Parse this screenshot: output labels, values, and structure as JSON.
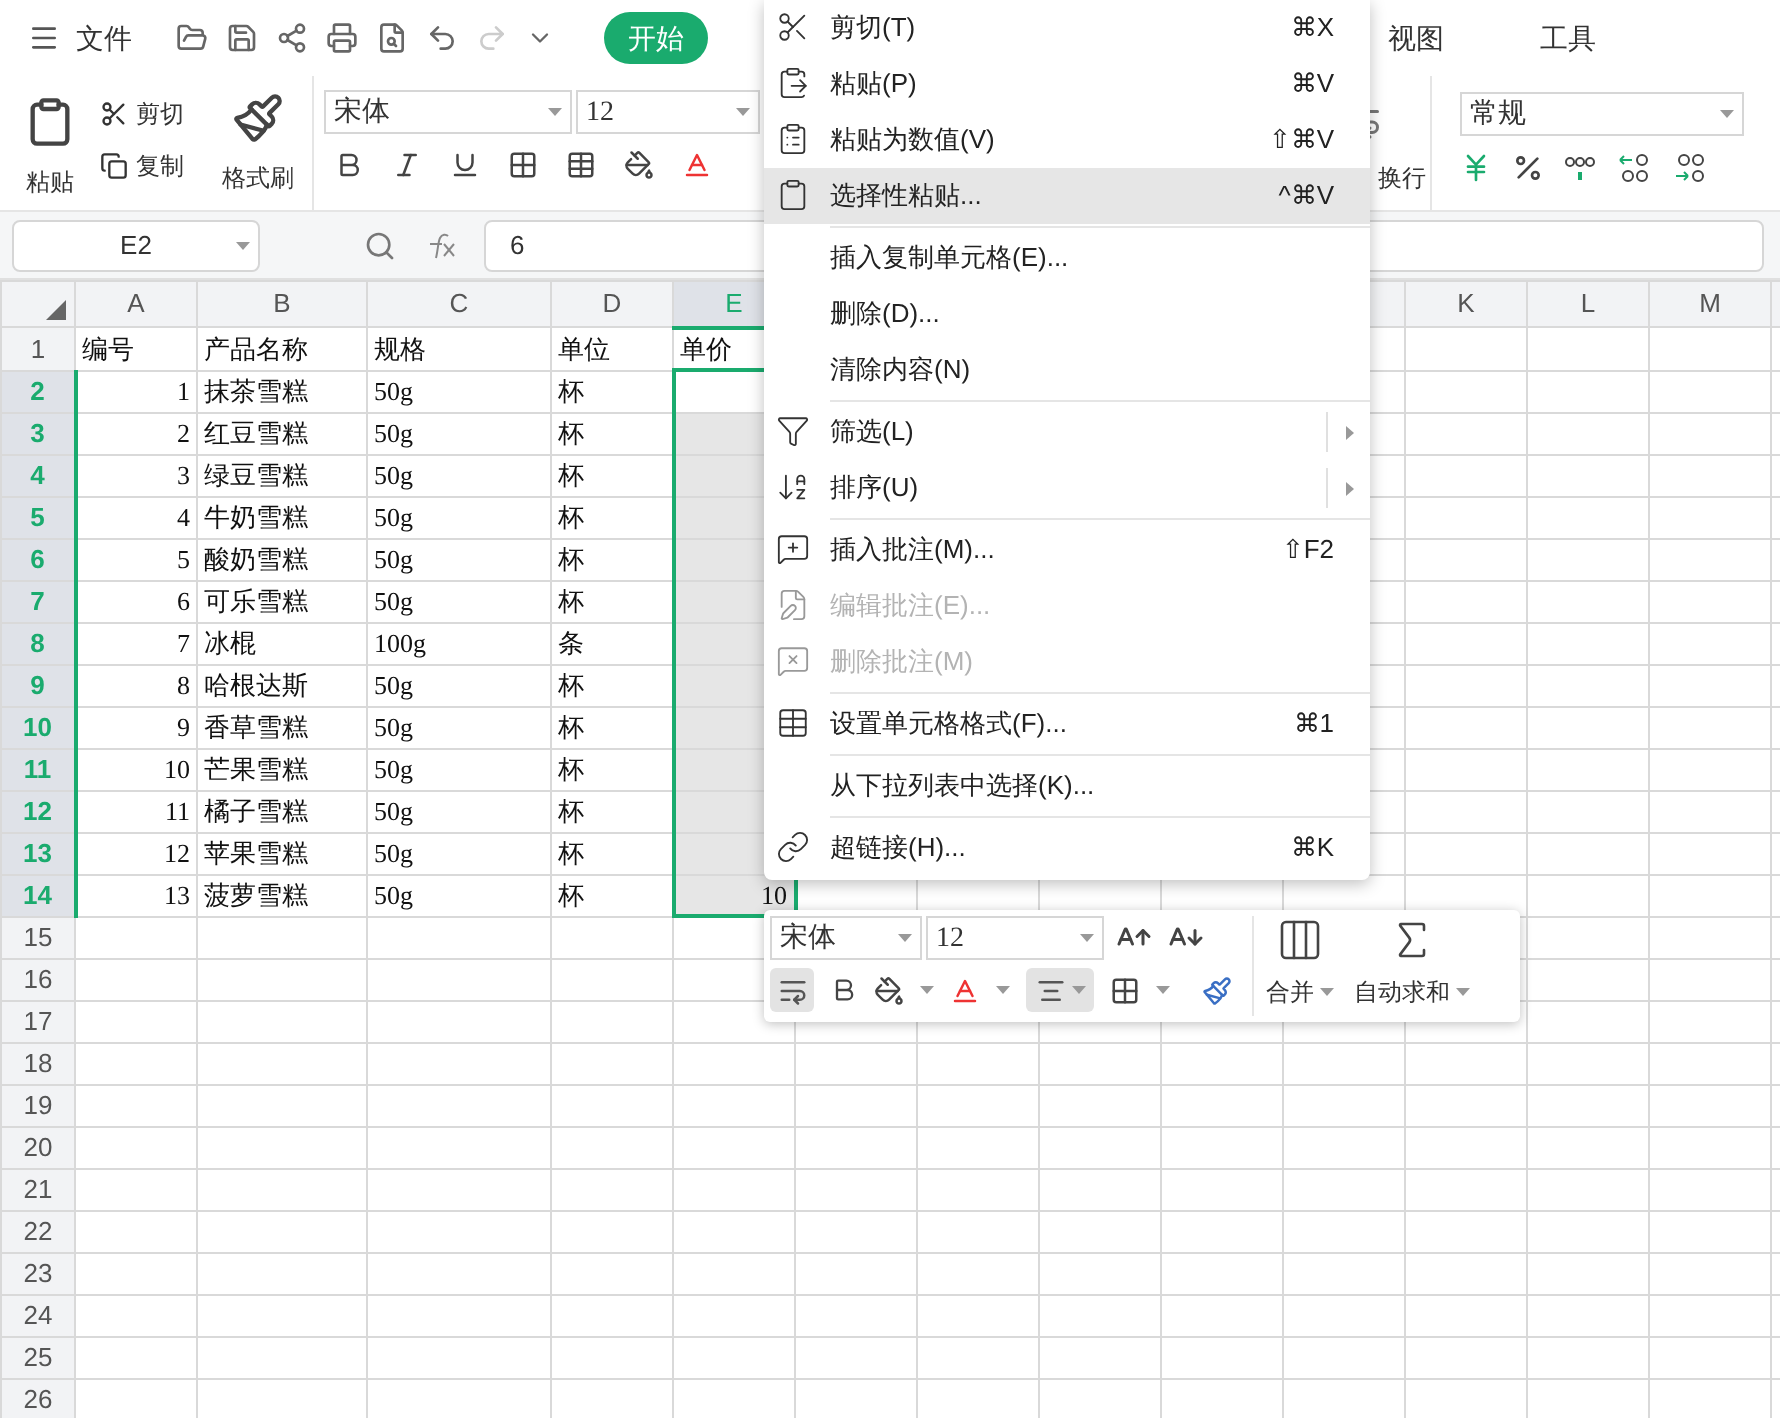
{
  "top_bar": {
    "menu_label": "文件",
    "tabs": [
      {
        "label": "开始",
        "selected": true
      },
      {
        "label": "视图",
        "selected": false
      },
      {
        "label": "工具",
        "selected": false
      }
    ]
  },
  "ribbon": {
    "paste": "粘贴",
    "cut": "剪切",
    "copy": "复制",
    "format_painter": "格式刷",
    "font": "宋体",
    "size": "12",
    "wrap": "换行",
    "number_format": "常规"
  },
  "formula_bar": {
    "cell_ref": "E2",
    "value": "6"
  },
  "sheet": {
    "columns": [
      {
        "label": "A",
        "selected": false
      },
      {
        "label": "B",
        "selected": false
      },
      {
        "label": "C",
        "selected": false
      },
      {
        "label": "D",
        "selected": false
      },
      {
        "label": "E",
        "selected": true
      },
      {
        "label": "K",
        "selected": false
      },
      {
        "label": "L",
        "selected": false
      },
      {
        "label": "M",
        "selected": false
      }
    ],
    "rows": [
      {
        "header": "1",
        "kind": "header",
        "selected": false,
        "active": false,
        "cells": [
          "编号",
          "产品名称",
          "规格",
          "单位",
          "单价"
        ]
      },
      {
        "header": "2",
        "kind": "data",
        "selected": true,
        "active": true,
        "cells": [
          "1",
          "抹茶雪糕",
          "50g",
          "杯"
        ]
      },
      {
        "header": "3",
        "kind": "data",
        "selected": true,
        "active": false,
        "cells": [
          "2",
          "红豆雪糕",
          "50g",
          "杯"
        ]
      },
      {
        "header": "4",
        "kind": "data",
        "selected": true,
        "active": false,
        "cells": [
          "3",
          "绿豆雪糕",
          "50g",
          "杯"
        ]
      },
      {
        "header": "5",
        "kind": "data",
        "selected": true,
        "active": false,
        "cells": [
          "4",
          "牛奶雪糕",
          "50g",
          "杯"
        ]
      },
      {
        "header": "6",
        "kind": "data",
        "selected": true,
        "active": false,
        "cells": [
          "5",
          "酸奶雪糕",
          "50g",
          "杯"
        ]
      },
      {
        "header": "7",
        "kind": "data",
        "selected": true,
        "active": false,
        "cells": [
          "6",
          "可乐雪糕",
          "50g",
          "杯"
        ]
      },
      {
        "header": "8",
        "kind": "data",
        "selected": true,
        "active": false,
        "cells": [
          "7",
          "冰棍",
          "100g",
          "条"
        ]
      },
      {
        "header": "9",
        "kind": "data",
        "selected": true,
        "active": false,
        "cells": [
          "8",
          "哈根达斯",
          "50g",
          "杯"
        ]
      },
      {
        "header": "10",
        "kind": "data",
        "selected": true,
        "active": false,
        "cells": [
          "9",
          "香草雪糕",
          "50g",
          "杯"
        ]
      },
      {
        "header": "11",
        "kind": "data",
        "selected": true,
        "active": false,
        "cells": [
          "10",
          "芒果雪糕",
          "50g",
          "杯"
        ]
      },
      {
        "header": "12",
        "kind": "data",
        "selected": true,
        "active": false,
        "cells": [
          "11",
          "橘子雪糕",
          "50g",
          "杯"
        ]
      },
      {
        "header": "13",
        "kind": "data",
        "selected": true,
        "active": false,
        "cells": [
          "12",
          "苹果雪糕",
          "50g",
          "杯"
        ]
      },
      {
        "header": "14",
        "kind": "data",
        "selected": true,
        "active": false,
        "cells": [
          "13",
          "菠萝雪糕",
          "50g",
          "杯",
          "10"
        ]
      },
      {
        "header": "15",
        "kind": "data",
        "selected": false,
        "active": false
      },
      {
        "header": "16",
        "kind": "data",
        "selected": false,
        "active": false
      },
      {
        "header": "17",
        "kind": "data",
        "selected": false,
        "active": false
      },
      {
        "header": "18",
        "kind": "data",
        "selected": false,
        "active": false
      },
      {
        "header": "19",
        "kind": "data",
        "selected": false,
        "active": false
      },
      {
        "header": "20",
        "kind": "data",
        "selected": false,
        "active": false
      },
      {
        "header": "21",
        "kind": "data",
        "selected": false,
        "active": false
      },
      {
        "header": "22",
        "kind": "data",
        "selected": false,
        "active": false
      },
      {
        "header": "23",
        "kind": "data",
        "selected": false,
        "active": false
      },
      {
        "header": "24",
        "kind": "data",
        "selected": false,
        "active": false
      },
      {
        "header": "25",
        "kind": "data",
        "selected": false,
        "active": false
      },
      {
        "header": "26",
        "kind": "data",
        "selected": false,
        "active": false
      }
    ]
  },
  "context_menu": [
    {
      "kind": "item",
      "label": "剪切(T)",
      "shortcut": "⌘X",
      "disabled": false,
      "selected": false,
      "submenu": false
    },
    {
      "kind": "item",
      "label": "粘贴(P)",
      "shortcut": "⌘V",
      "disabled": false,
      "selected": false,
      "submenu": false
    },
    {
      "kind": "item",
      "label": "粘贴为数值(V)",
      "shortcut": "⇧⌘V",
      "disabled": false,
      "selected": false,
      "submenu": false
    },
    {
      "kind": "item",
      "label": "选择性粘贴...",
      "shortcut": "^⌘V",
      "disabled": false,
      "selected": true,
      "submenu": false
    },
    {
      "kind": "separator"
    },
    {
      "kind": "item",
      "label": "插入复制单元格(E)...",
      "disabled": false,
      "selected": false,
      "submenu": false
    },
    {
      "kind": "item",
      "label": "删除(D)...",
      "disabled": false,
      "selected": false,
      "submenu": false
    },
    {
      "kind": "item",
      "label": "清除内容(N)",
      "disabled": false,
      "selected": false,
      "submenu": false
    },
    {
      "kind": "separator"
    },
    {
      "kind": "item",
      "label": "筛选(L)",
      "disabled": false,
      "selected": false,
      "submenu": true
    },
    {
      "kind": "item",
      "label": "排序(U)",
      "disabled": false,
      "selected": false,
      "submenu": true
    },
    {
      "kind": "separator"
    },
    {
      "kind": "item",
      "label": "插入批注(M)...",
      "shortcut": "⇧F2",
      "disabled": false,
      "selected": false,
      "submenu": false
    },
    {
      "kind": "item",
      "label": "编辑批注(E)...",
      "disabled": true,
      "selected": false,
      "submenu": false
    },
    {
      "kind": "item",
      "label": "删除批注(M)",
      "disabled": true,
      "selected": false,
      "submenu": false
    },
    {
      "kind": "separator"
    },
    {
      "kind": "item",
      "label": "设置单元格格式(F)...",
      "shortcut": "⌘1",
      "disabled": false,
      "selected": false,
      "submenu": false
    },
    {
      "kind": "separator"
    },
    {
      "kind": "item",
      "label": "从下拉列表中选择(K)...",
      "disabled": false,
      "selected": false,
      "submenu": false
    },
    {
      "kind": "separator"
    },
    {
      "kind": "item",
      "label": "超链接(H)...",
      "shortcut": "⌘K",
      "disabled": false,
      "selected": false,
      "submenu": false
    }
  ],
  "mini_toolbar": {
    "font": "宋体",
    "size": "12",
    "wrap_on": true,
    "center_on": true,
    "merge": "合并",
    "autosum": "自动求和"
  }
}
